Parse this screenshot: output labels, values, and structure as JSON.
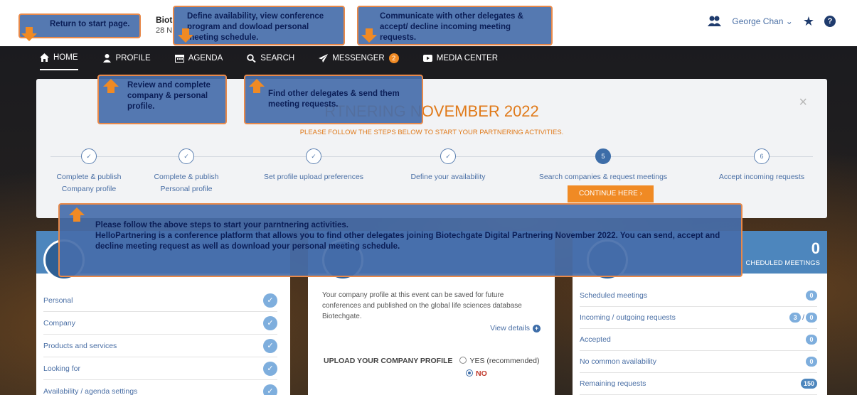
{
  "header": {
    "brand_name": "Biot",
    "brand_date": "28 N",
    "user_name": "George Chan",
    "user_icon": "users-icon",
    "star_icon": "star-icon",
    "help_icon": "help-icon"
  },
  "nav": {
    "items": [
      {
        "label": "HOME",
        "icon": "home-icon"
      },
      {
        "label": "PROFILE",
        "icon": "user-icon"
      },
      {
        "label": "AGENDA",
        "icon": "calendar-icon"
      },
      {
        "label": "SEARCH",
        "icon": "search-icon"
      },
      {
        "label": "MESSENGER",
        "icon": "send-icon",
        "badge": "2"
      },
      {
        "label": "MEDIA CENTER",
        "icon": "play-icon"
      }
    ]
  },
  "panel": {
    "title": "RTNERING NOVEMBER 2022",
    "subtitle": "PLEASE FOLLOW THE STEPS BELOW TO START YOUR PARTNERING ACTIVITIES.",
    "close": "×",
    "steps": [
      {
        "marker": "✓",
        "line1": "Complete & publish",
        "line2": "Company profile"
      },
      {
        "marker": "✓",
        "line1": "Complete & publish",
        "line2": "Personal profile"
      },
      {
        "marker": "✓",
        "line1": "Set profile upload preferences",
        "line2": ""
      },
      {
        "marker": "✓",
        "line1": "Define your availability",
        "line2": ""
      },
      {
        "marker": "5",
        "line1": "Search companies & request meetings",
        "line2": ""
      },
      {
        "marker": "6",
        "line1": "Accept incoming requests",
        "line2": ""
      }
    ],
    "continue_label": "CONTINUE HERE  ›"
  },
  "left_col": {
    "items": [
      "Personal",
      "Company",
      "Products and services",
      "Looking for",
      "Availability / agenda settings"
    ],
    "check": "✓"
  },
  "mid_col": {
    "text": "Your company profile at this event can be saved for future conferences and published on the global life sciences database Biotechgate.",
    "view_details": "View details",
    "upload_label": "UPLOAD YOUR COMPANY PROFILE",
    "opt_yes": "YES (recommended)",
    "opt_no": "NO"
  },
  "right_col": {
    "big_number": "0",
    "big_label": "CHEDULED MEETINGS",
    "rows": [
      {
        "label": "Scheduled meetings",
        "value": "0"
      },
      {
        "label": "Incoming / outgoing requests",
        "value": "3",
        "value2": "0"
      },
      {
        "label": "Accepted",
        "value": "0"
      },
      {
        "label": "No common availability",
        "value": "0"
      },
      {
        "label": "Remaining requests",
        "value": "150"
      }
    ]
  },
  "callouts": {
    "start": "Return to start page.",
    "agenda": "Define availability, view conference program and dowload personal meeting schedule.",
    "messenger": "Communicate with other delegates & accept/ decline incoming meeting requests.",
    "profile": "Review and complete company & personal profile.",
    "search": "Find other delegates & send them meeting requests.",
    "main_line1": "Please follow the above steps to start your parntnering activities.",
    "main_line2": "HelloPartnering is a conference platform that allows you to find other delegates joining Biotechgate Digital Partnering November 2022. You can send, accept and decline meeting request as well as download your personal meeting schedule."
  }
}
